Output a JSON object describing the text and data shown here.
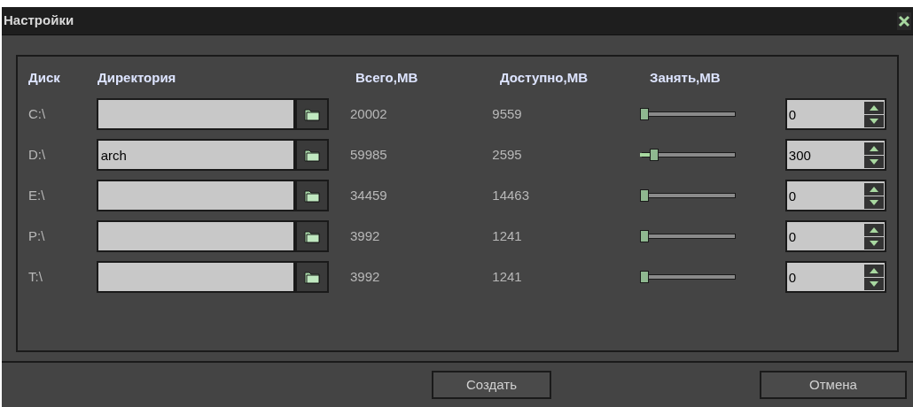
{
  "window": {
    "title": "Настройки"
  },
  "columns": [
    "Диск",
    "Директория",
    "Всего,MB",
    "Доступно,MB",
    "Занять,MB"
  ],
  "rows": [
    {
      "disk": "C:\\",
      "directory": "",
      "total": "20002",
      "available": "9559",
      "level": 0,
      "reserve": "0"
    },
    {
      "disk": "D:\\",
      "directory": "arch",
      "total": "59985",
      "available": "2595",
      "level": 0.12,
      "reserve": "300"
    },
    {
      "disk": "E:\\",
      "directory": "",
      "total": "34459",
      "available": "14463",
      "level": 0,
      "reserve": "0"
    },
    {
      "disk": "P:\\",
      "directory": "",
      "total": "3992",
      "available": "1241",
      "level": 0,
      "reserve": "0"
    },
    {
      "disk": "T:\\",
      "directory": "",
      "total": "3992",
      "available": "1241",
      "level": 0,
      "reserve": "0"
    }
  ],
  "buttons": [
    "Создать",
    "Отмена"
  ]
}
